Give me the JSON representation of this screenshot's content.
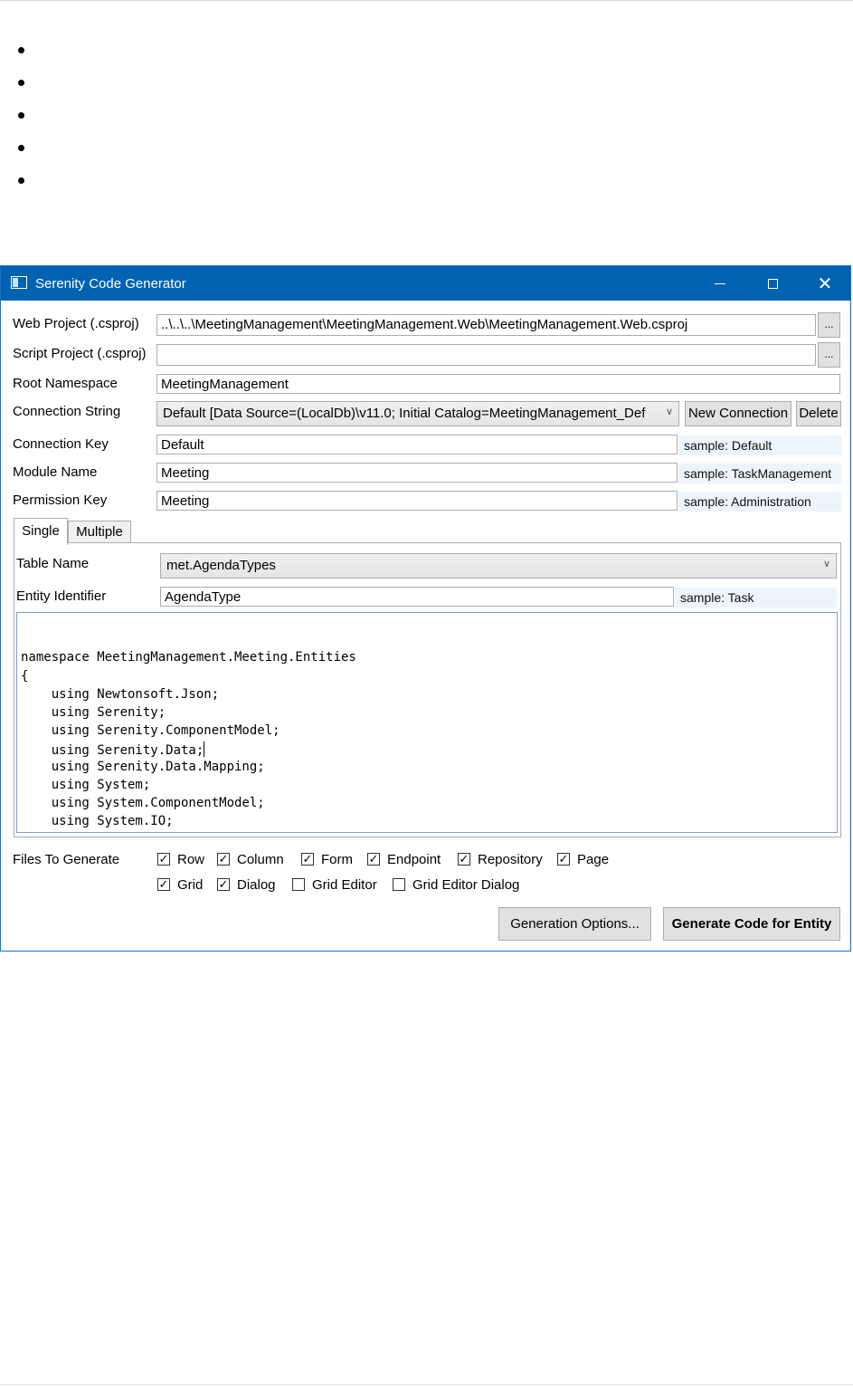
{
  "window": {
    "title": "Serenity Code Generator",
    "icons": {
      "app": "app-window-icon",
      "minimize": "minimize-icon",
      "maximize": "maximize-icon",
      "close": "close-icon"
    },
    "close_glyph": "✕"
  },
  "form": {
    "web_project": {
      "label": "Web Project (.csproj)",
      "value": "..\\..\\..\\MeetingManagement\\MeetingManagement.Web\\MeetingManagement.Web.csproj",
      "browse": "..."
    },
    "script_project": {
      "label": "Script Project (.csproj)",
      "value": "",
      "browse": "..."
    },
    "root_namespace": {
      "label": "Root Namespace",
      "value": "MeetingManagement"
    },
    "connection_string": {
      "label": "Connection String",
      "value": "Default [Data Source=(LocalDb)\\v11.0; Initial Catalog=MeetingManagement_Def",
      "new_button": "New Connection",
      "delete_button": "Delete"
    },
    "connection_key": {
      "label": "Connection Key",
      "value": "Default",
      "sample": "sample: Default"
    },
    "module_name": {
      "label": "Module Name",
      "value": "Meeting",
      "sample": "sample: TaskManagement"
    },
    "permission_key": {
      "label": "Permission Key",
      "value": "Meeting",
      "sample": "sample: Administration"
    }
  },
  "tabs": [
    "Single",
    "Multiple"
  ],
  "single": {
    "table_name": {
      "label": "Table Name",
      "value": "met.AgendaTypes"
    },
    "entity_identifier": {
      "label": "Entity Identifier",
      "value": "AgendaType",
      "sample": "sample: Task"
    }
  },
  "code_lines": [
    "namespace MeetingManagement.Meeting.Entities",
    "{",
    "    using Newtonsoft.Json;",
    "    using Serenity;",
    "    using Serenity.ComponentModel;",
    "    using Serenity.Data;",
    "    using Serenity.Data.Mapping;",
    "    using System;",
    "    using System.ComponentModel;",
    "    using System.IO;"
  ],
  "files_to_generate": {
    "label": "Files To Generate",
    "options": [
      {
        "name": "Row",
        "checked": true
      },
      {
        "name": "Column",
        "checked": true
      },
      {
        "name": "Form",
        "checked": true
      },
      {
        "name": "Endpoint",
        "checked": true
      },
      {
        "name": "Repository",
        "checked": true
      },
      {
        "name": "Page",
        "checked": true
      },
      {
        "name": "Grid",
        "checked": true
      },
      {
        "name": "Dialog",
        "checked": true
      },
      {
        "name": "Grid Editor",
        "checked": false
      },
      {
        "name": "Grid Editor Dialog",
        "checked": false
      }
    ],
    "check_glyph": "✓"
  },
  "buttons": {
    "generation_options": "Generation Options...",
    "generate": "Generate Code for Entity"
  },
  "colors": {
    "titlebar": "#0063b1",
    "sample_bg": "#eef4fb"
  }
}
